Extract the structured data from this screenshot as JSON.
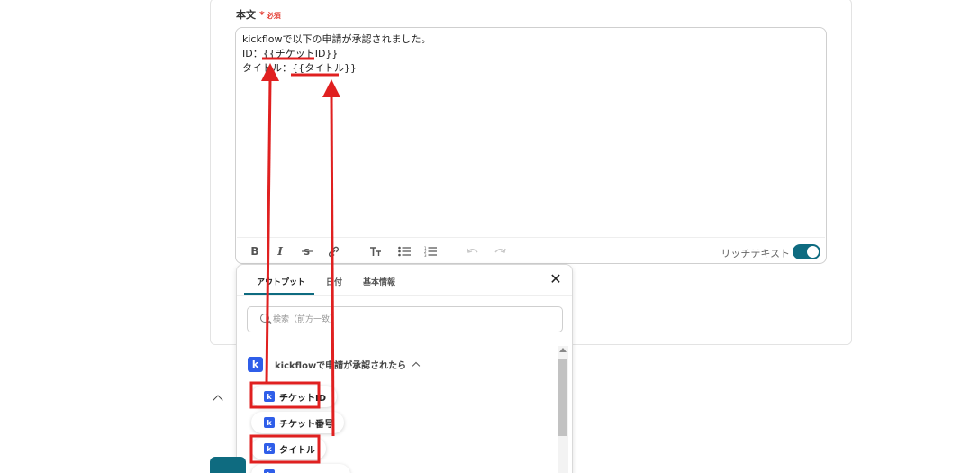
{
  "field": {
    "label": "本文",
    "required_star": "*",
    "required_text": "必須"
  },
  "editor": {
    "content": "kickflowで以下の申請が承認されました。\nID：{{チケットID}}\nタイトル：{{タイトル}}",
    "rich_text_label": "リッチテキスト",
    "rich_text_enabled": true
  },
  "toolbar": {
    "icons": [
      "bold-icon",
      "italic-icon",
      "strikethrough-icon",
      "link-icon",
      "text-size-icon",
      "bullet-list-icon",
      "numbered-list-icon",
      "undo-icon",
      "redo-icon"
    ]
  },
  "popup": {
    "tabs": [
      "アウトプット",
      "日付",
      "基本情報"
    ],
    "active_tab": 0,
    "search_placeholder": "検索（前方一致）",
    "group_title": "kickflowで申請が承認されたら",
    "items": [
      "チケットID",
      "チケット番号",
      "タイトル"
    ]
  },
  "colors": {
    "accent": "#0e6b80",
    "annotation_red": "#e02020",
    "kickflow_blue": "#2f5ee9"
  }
}
